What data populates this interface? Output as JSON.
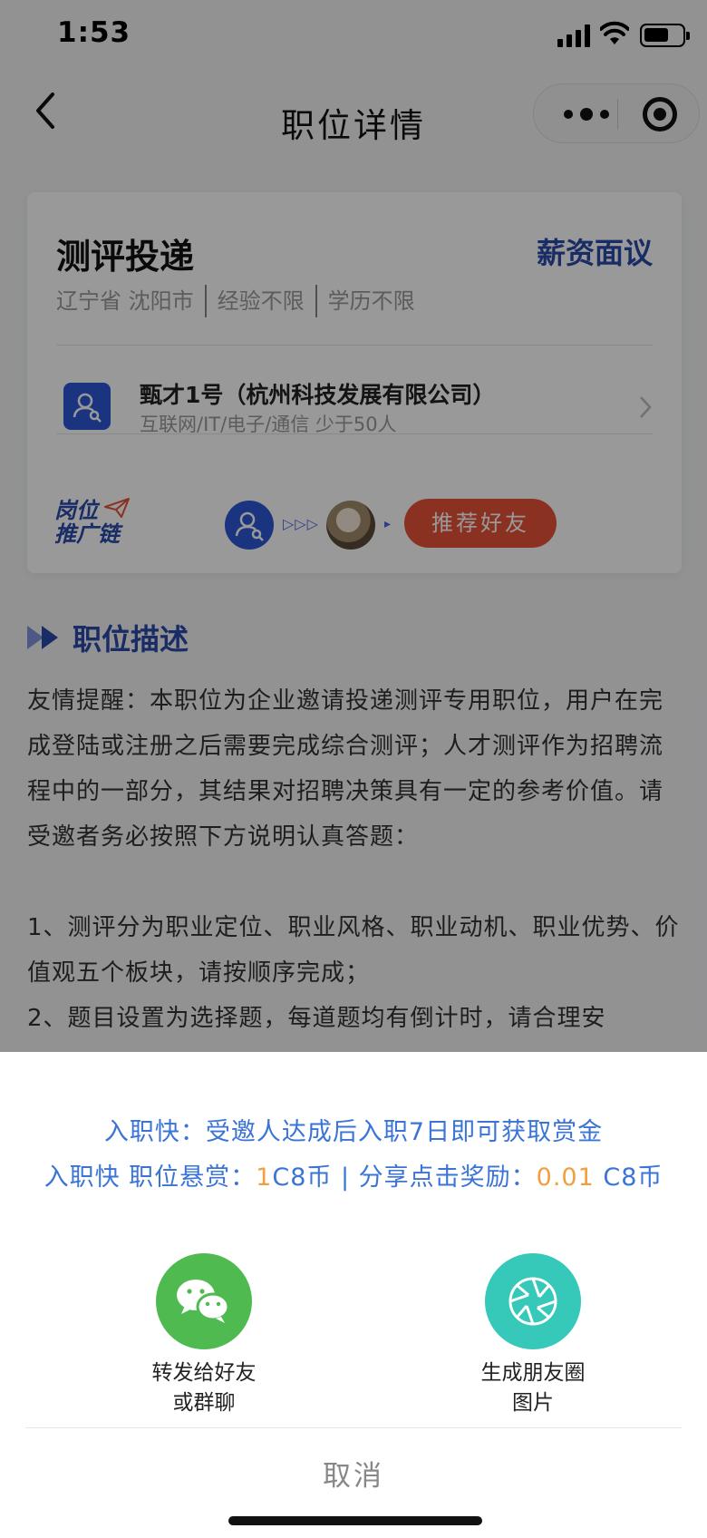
{
  "status_bar": {
    "time": "1:53"
  },
  "nav": {
    "title": "职位详情"
  },
  "job": {
    "title": "测评投递",
    "salary": "薪资面议",
    "tags": [
      "辽宁省 沈阳市",
      "经验不限",
      "学历不限"
    ]
  },
  "company": {
    "name": "甄才1号（杭州科技发展有限公司）",
    "info": "互联网/IT/电子/通信 少于50人"
  },
  "promo": {
    "label_line1": "岗位",
    "label_line2": "推广链",
    "arrows": "▷▷▷",
    "arrow_small": "▸",
    "recommend_label": "推荐好友"
  },
  "description": {
    "section_title": "职位描述",
    "paragraph1": "友情提醒：本职位为企业邀请投递测评专用职位，用户在完成登陆或注册之后需要完成综合测评；人才测评作为招聘流程中的一部分，其结果对招聘决策具有一定的参考价值。请受邀者务必按照下方说明认真答题：",
    "item1": "1、测评分为职业定位、职业风格、职业动机、职业优势、价值观五个板块，请按顺序完成；",
    "item2": "2、题目设置为选择题，每道题均有倒计时，请合理安"
  },
  "share_sheet": {
    "tip_line1": "入职快：受邀人达成后入职7日即可获取赏金",
    "tip2_prefix": "入职快 职位悬赏：",
    "tip2_reward_num": "1",
    "tip2_reward_unit": "C8币 | 分享点击奖励：",
    "tip2_click_num": "0.01",
    "tip2_click_unit": " C8币",
    "wechat_label_line1": "转发给好友",
    "wechat_label_line2": "或群聊",
    "moments_label_line1": "生成朋友圈",
    "moments_label_line2": "图片",
    "cancel_label": "取消"
  },
  "colors": {
    "brand_blue": "#2b4aa8",
    "link_blue": "#3a74d6",
    "reward_orange": "#f0a040",
    "recommend_red": "#e7523a",
    "wechat_green": "#4fba4f",
    "moments_teal": "#36c8b8"
  }
}
